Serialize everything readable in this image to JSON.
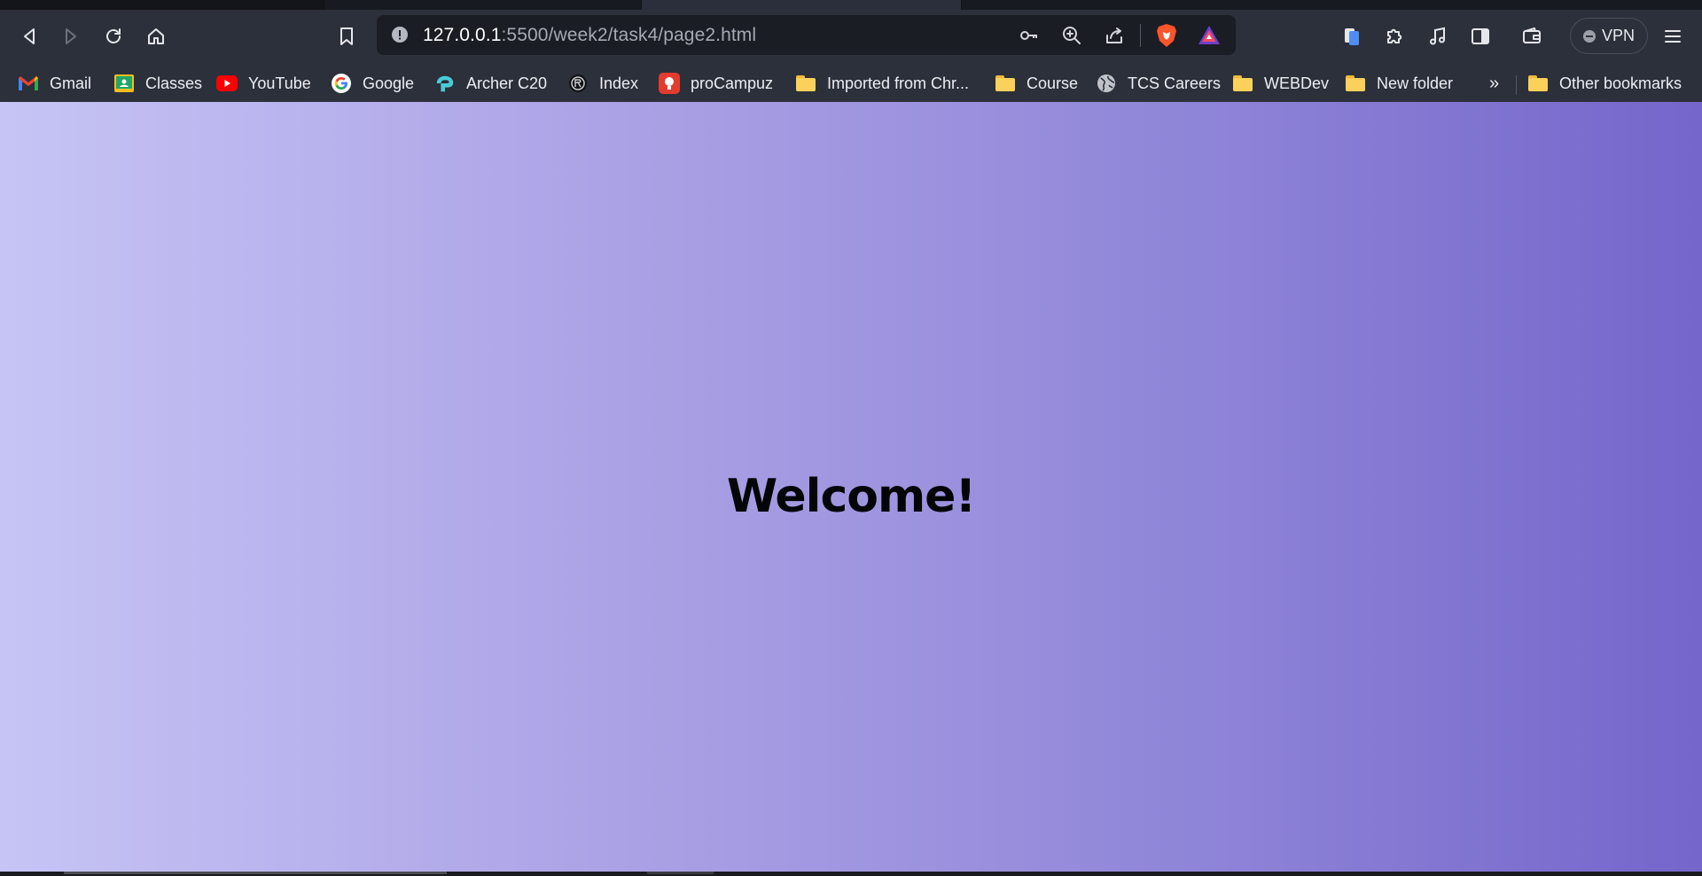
{
  "browser": {
    "address_bar": {
      "host": "127.0.0.1",
      "path": ":5500/week2/task4/page2.html"
    },
    "vpn_label": "VPN",
    "bookmarks": [
      {
        "label": "Gmail",
        "icon": "gmail-icon"
      },
      {
        "label": "Classes",
        "icon": "classroom-icon"
      },
      {
        "label": "YouTube",
        "icon": "youtube-icon"
      },
      {
        "label": "Google",
        "icon": "google-icon"
      },
      {
        "label": "Archer C20",
        "icon": "tplink-icon"
      },
      {
        "label": "Index",
        "icon": "index-icon"
      },
      {
        "label": "proCampuz",
        "icon": "procampuz-icon"
      },
      {
        "label": "Imported from Chr...",
        "icon": "folder-icon"
      },
      {
        "label": "Course",
        "icon": "folder-icon"
      },
      {
        "label": "TCS Careers",
        "icon": "globe-icon"
      },
      {
        "label": "WEBDev",
        "icon": "folder-icon"
      },
      {
        "label": "New folder",
        "icon": "folder-icon"
      }
    ],
    "overflow_label": "»",
    "other_bookmarks": "Other bookmarks"
  },
  "page": {
    "heading": "Welcome!"
  },
  "colors": {
    "toolbar_bg": "#2c303b",
    "omnibox_bg": "#1b1d24",
    "gradient_start": "#c6c4f5",
    "gradient_end": "#7466cb",
    "heading_color": "#050508"
  }
}
